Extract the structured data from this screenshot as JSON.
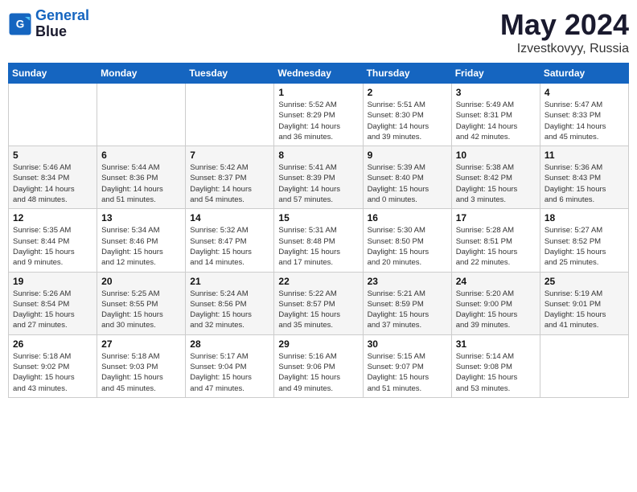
{
  "logo": {
    "line1": "General",
    "line2": "Blue"
  },
  "header": {
    "month": "May 2024",
    "location": "Izvestkovyy, Russia"
  },
  "days_of_week": [
    "Sunday",
    "Monday",
    "Tuesday",
    "Wednesday",
    "Thursday",
    "Friday",
    "Saturday"
  ],
  "weeks": [
    [
      {
        "day": "",
        "info": ""
      },
      {
        "day": "",
        "info": ""
      },
      {
        "day": "",
        "info": ""
      },
      {
        "day": "1",
        "info": "Sunrise: 5:52 AM\nSunset: 8:29 PM\nDaylight: 14 hours\nand 36 minutes."
      },
      {
        "day": "2",
        "info": "Sunrise: 5:51 AM\nSunset: 8:30 PM\nDaylight: 14 hours\nand 39 minutes."
      },
      {
        "day": "3",
        "info": "Sunrise: 5:49 AM\nSunset: 8:31 PM\nDaylight: 14 hours\nand 42 minutes."
      },
      {
        "day": "4",
        "info": "Sunrise: 5:47 AM\nSunset: 8:33 PM\nDaylight: 14 hours\nand 45 minutes."
      }
    ],
    [
      {
        "day": "5",
        "info": "Sunrise: 5:46 AM\nSunset: 8:34 PM\nDaylight: 14 hours\nand 48 minutes."
      },
      {
        "day": "6",
        "info": "Sunrise: 5:44 AM\nSunset: 8:36 PM\nDaylight: 14 hours\nand 51 minutes."
      },
      {
        "day": "7",
        "info": "Sunrise: 5:42 AM\nSunset: 8:37 PM\nDaylight: 14 hours\nand 54 minutes."
      },
      {
        "day": "8",
        "info": "Sunrise: 5:41 AM\nSunset: 8:39 PM\nDaylight: 14 hours\nand 57 minutes."
      },
      {
        "day": "9",
        "info": "Sunrise: 5:39 AM\nSunset: 8:40 PM\nDaylight: 15 hours\nand 0 minutes."
      },
      {
        "day": "10",
        "info": "Sunrise: 5:38 AM\nSunset: 8:42 PM\nDaylight: 15 hours\nand 3 minutes."
      },
      {
        "day": "11",
        "info": "Sunrise: 5:36 AM\nSunset: 8:43 PM\nDaylight: 15 hours\nand 6 minutes."
      }
    ],
    [
      {
        "day": "12",
        "info": "Sunrise: 5:35 AM\nSunset: 8:44 PM\nDaylight: 15 hours\nand 9 minutes."
      },
      {
        "day": "13",
        "info": "Sunrise: 5:34 AM\nSunset: 8:46 PM\nDaylight: 15 hours\nand 12 minutes."
      },
      {
        "day": "14",
        "info": "Sunrise: 5:32 AM\nSunset: 8:47 PM\nDaylight: 15 hours\nand 14 minutes."
      },
      {
        "day": "15",
        "info": "Sunrise: 5:31 AM\nSunset: 8:48 PM\nDaylight: 15 hours\nand 17 minutes."
      },
      {
        "day": "16",
        "info": "Sunrise: 5:30 AM\nSunset: 8:50 PM\nDaylight: 15 hours\nand 20 minutes."
      },
      {
        "day": "17",
        "info": "Sunrise: 5:28 AM\nSunset: 8:51 PM\nDaylight: 15 hours\nand 22 minutes."
      },
      {
        "day": "18",
        "info": "Sunrise: 5:27 AM\nSunset: 8:52 PM\nDaylight: 15 hours\nand 25 minutes."
      }
    ],
    [
      {
        "day": "19",
        "info": "Sunrise: 5:26 AM\nSunset: 8:54 PM\nDaylight: 15 hours\nand 27 minutes."
      },
      {
        "day": "20",
        "info": "Sunrise: 5:25 AM\nSunset: 8:55 PM\nDaylight: 15 hours\nand 30 minutes."
      },
      {
        "day": "21",
        "info": "Sunrise: 5:24 AM\nSunset: 8:56 PM\nDaylight: 15 hours\nand 32 minutes."
      },
      {
        "day": "22",
        "info": "Sunrise: 5:22 AM\nSunset: 8:57 PM\nDaylight: 15 hours\nand 35 minutes."
      },
      {
        "day": "23",
        "info": "Sunrise: 5:21 AM\nSunset: 8:59 PM\nDaylight: 15 hours\nand 37 minutes."
      },
      {
        "day": "24",
        "info": "Sunrise: 5:20 AM\nSunset: 9:00 PM\nDaylight: 15 hours\nand 39 minutes."
      },
      {
        "day": "25",
        "info": "Sunrise: 5:19 AM\nSunset: 9:01 PM\nDaylight: 15 hours\nand 41 minutes."
      }
    ],
    [
      {
        "day": "26",
        "info": "Sunrise: 5:18 AM\nSunset: 9:02 PM\nDaylight: 15 hours\nand 43 minutes."
      },
      {
        "day": "27",
        "info": "Sunrise: 5:18 AM\nSunset: 9:03 PM\nDaylight: 15 hours\nand 45 minutes."
      },
      {
        "day": "28",
        "info": "Sunrise: 5:17 AM\nSunset: 9:04 PM\nDaylight: 15 hours\nand 47 minutes."
      },
      {
        "day": "29",
        "info": "Sunrise: 5:16 AM\nSunset: 9:06 PM\nDaylight: 15 hours\nand 49 minutes."
      },
      {
        "day": "30",
        "info": "Sunrise: 5:15 AM\nSunset: 9:07 PM\nDaylight: 15 hours\nand 51 minutes."
      },
      {
        "day": "31",
        "info": "Sunrise: 5:14 AM\nSunset: 9:08 PM\nDaylight: 15 hours\nand 53 minutes."
      },
      {
        "day": "",
        "info": ""
      }
    ]
  ]
}
